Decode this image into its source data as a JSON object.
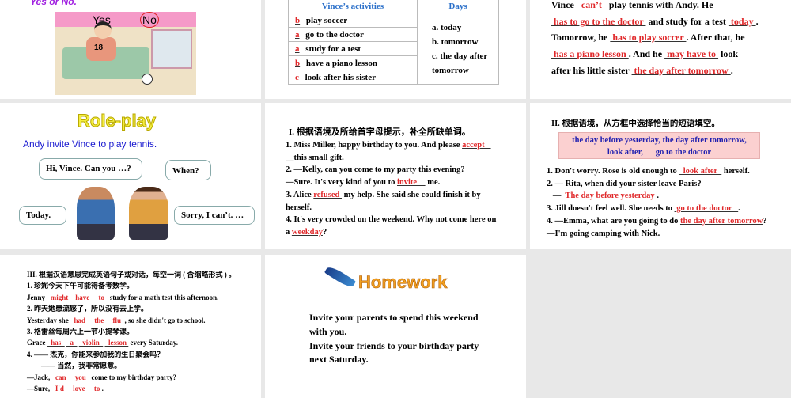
{
  "slides": {
    "s1": {
      "prompt": "Yes or No.",
      "yes": "Yes",
      "no": "No",
      "shirt_number": "18"
    },
    "s2": {
      "headers": [
        "Vince’s activities",
        "Days"
      ],
      "rows": [
        {
          "ans": "b",
          "text": "play soccer"
        },
        {
          "ans": "a",
          "text": "go to the doctor"
        },
        {
          "ans": "a",
          "text": "study for a test"
        },
        {
          "ans": "b",
          "text": "have a piano lesson"
        },
        {
          "ans": "c",
          "text": "look after his sister"
        }
      ],
      "days": [
        "a. today",
        "b. tomorrow",
        "c. the day after",
        "tomorrow"
      ]
    },
    "s3": {
      "lines": [
        [
          {
            "t": "Vince "
          },
          {
            "a": "  can’t  "
          },
          {
            "t": " play tennis with Andy. He"
          }
        ],
        [
          {
            "a": " has to go to the doctor "
          },
          {
            "t": " and study for a test "
          },
          {
            "a": " today "
          },
          {
            "t": "."
          }
        ],
        [
          {
            "t": "Tomorrow, he "
          },
          {
            "a": " has to play soccer "
          },
          {
            "t": ". After that, he"
          }
        ],
        [
          {
            "a": " has a piano lesson "
          },
          {
            "t": ". And he "
          },
          {
            "a": " may have to "
          },
          {
            "t": " look"
          }
        ],
        [
          {
            "t": "after his little sister "
          },
          {
            "a": " the day after tomorrow "
          },
          {
            "t": "."
          }
        ]
      ]
    },
    "s4": {
      "title": "Role-play",
      "subtitle": "Andy invite Vince to play tennis.",
      "bubbles": [
        "Hi, Vince. Can you …?",
        "When?",
        "Today.",
        "Sorry, I can’t. …"
      ]
    },
    "s5": {
      "heading": "I. 根据语境及所给首字母提示，补全所缺单词。",
      "lines": [
        [
          {
            "t": "1. Miss Miller, happy birthday to you. And please "
          },
          {
            "a": "accept   "
          }
        ],
        [
          {
            "t": "__this small gift."
          }
        ],
        [
          {
            "t": "2. —Kelly, can you come to my party this evening?"
          }
        ],
        [
          {
            "t": "—Sure. It's very kind of you to "
          },
          {
            "a": "invite    "
          },
          {
            "t": " me."
          }
        ],
        [
          {
            "t": "3. Alice "
          },
          {
            "a": "refused "
          },
          {
            "t": " my help. She said she could finish it by"
          }
        ],
        [
          {
            "t": "herself."
          }
        ],
        [
          {
            "t": "4. It's very crowded on the weekend. Why not come here on"
          }
        ],
        [
          {
            "t": "a "
          },
          {
            "a": "weekday"
          },
          {
            "t": "?"
          }
        ]
      ]
    },
    "s6": {
      "heading": "II. 根据语境，从方框中选择恰当的短语填空。",
      "box": [
        "the day before yesterday,  the day after tomorrow,",
        "look after,      go to the doctor"
      ],
      "lines": [
        [
          {
            "t": "1. Don't worry. Rose is old enough to "
          },
          {
            "a": "  look after  "
          },
          {
            "t": " herself."
          }
        ],
        [
          {
            "t": "2. — Rita, when did your sister leave Paris?"
          }
        ],
        [
          {
            "t": "   — "
          },
          {
            "a": " The day before yesterday "
          },
          {
            "t": "."
          }
        ],
        [
          {
            "t": "3. Jill doesn't feel well. She needs to "
          },
          {
            "a": " go to the doctor   "
          },
          {
            "t": "."
          }
        ],
        [
          {
            "t": "4. —Emma, what are you going to do "
          },
          {
            "a": "the day after tomorrow"
          },
          {
            "t": "?"
          }
        ],
        [
          {
            "t": "—I'm going camping with Nick."
          }
        ]
      ]
    },
    "s7": {
      "lines": [
        [
          {
            "t": "III. 根据汉语意思完成英语句子或对话，每空一词 ( 含缩略形式 ) 。"
          }
        ],
        [
          {
            "t": "1. 珍妮今天下午可能得备考数学。"
          }
        ],
        [
          {
            "t": "Jenny "
          },
          {
            "a": "  might "
          },
          {
            "t": " "
          },
          {
            "a": "  have  "
          },
          {
            "t": " "
          },
          {
            "a": "  to  "
          },
          {
            "t": " study for a math test this afternoon."
          }
        ],
        [
          {
            "t": "2. 昨天她患流感了，所以没有去上学。"
          }
        ],
        [
          {
            "t": "Yesterday she "
          },
          {
            "a": "  had  "
          },
          {
            "t": " "
          },
          {
            "a": "  the  "
          },
          {
            "t": " "
          },
          {
            "a": "  flu  "
          },
          {
            "t": ", so she didn't go to school."
          }
        ],
        [
          {
            "t": "3. 格雷丝每周六上一节小提琴课。"
          }
        ],
        [
          {
            "t": "Grace "
          },
          {
            "a": "  has  "
          },
          {
            "t": " "
          },
          {
            "a": "  a  "
          },
          {
            "t": " "
          },
          {
            "a": "  violin  "
          },
          {
            "t": " "
          },
          {
            "a": "  lesson "
          },
          {
            "t": " every Saturday."
          }
        ],
        [
          {
            "t": "4. —— 杰克，你能来参加我的生日聚会吗？"
          }
        ],
        [
          {
            "t": "        —— 当然，我非常愿意。"
          }
        ],
        [
          {
            "t": "—Jack, "
          },
          {
            "a": "  can  "
          },
          {
            "t": " "
          },
          {
            "a": "  you  "
          },
          {
            "t": " come to my birthday party?"
          }
        ],
        [
          {
            "t": "—Sure, "
          },
          {
            "a": "  I'd  "
          },
          {
            "t": " "
          },
          {
            "a": "  love  "
          },
          {
            "t": " "
          },
          {
            "a": "  to "
          },
          {
            "t": "."
          }
        ]
      ]
    },
    "s8": {
      "title": "Homework",
      "lines": [
        "Invite your parents to spend this weekend",
        "with you.",
        "Invite your friends to your birthday party",
        "next Saturday."
      ]
    }
  },
  "colors": {
    "answer": "#e0282a",
    "heading_blue": "#2a6fc9",
    "prompt_purple": "#a020e0",
    "pink": "#f59ac8"
  }
}
